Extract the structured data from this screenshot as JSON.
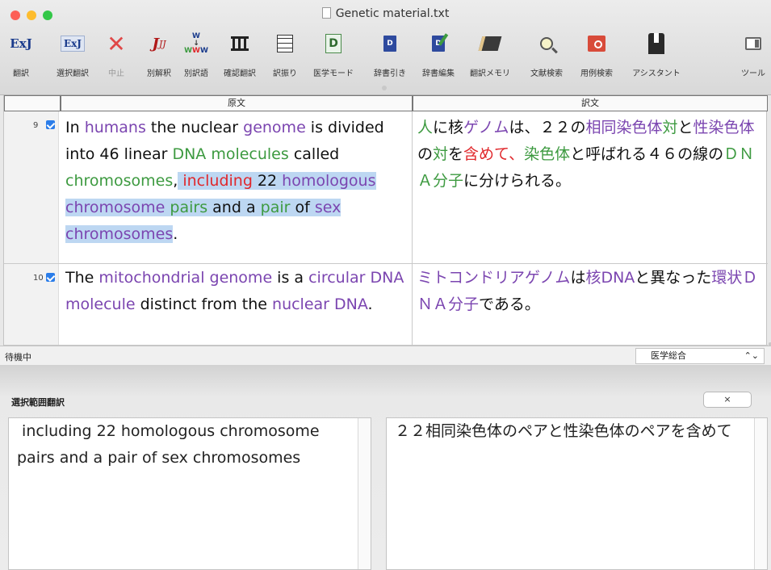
{
  "window": {
    "title": "Genetic material.txt",
    "traffic_colors": [
      "#fc5f57",
      "#fdbc2e",
      "#33c748"
    ]
  },
  "toolbar": [
    {
      "id": "translate",
      "label": "翻訳",
      "icon": "exj-translate-icon",
      "glyph": "ExJ"
    },
    {
      "id": "selection-translate",
      "label": "選択翻訳",
      "icon": "exj-selection-icon",
      "glyph": "ExJ"
    },
    {
      "id": "stop",
      "label": "中止",
      "icon": "stop-x-icon",
      "glyph": "✕"
    },
    {
      "id": "alt-interpretation",
      "label": "別解釈",
      "icon": "alt-interpretation-icon",
      "glyph": "J"
    },
    {
      "id": "alt-word",
      "label": "別訳語",
      "icon": "alt-word-icon",
      "glyph": "W"
    },
    {
      "id": "confirm",
      "label": "確認翻訳",
      "icon": "confirm-columns-icon",
      "glyph": "Ⅲ"
    },
    {
      "id": "furigana",
      "label": "訳振り",
      "icon": "lines-icon",
      "glyph": "☰"
    },
    {
      "id": "medical",
      "label": "医学モード",
      "icon": "medical-mode-icon",
      "glyph": "D"
    },
    {
      "id": "dict-lookup",
      "label": "辞書引き",
      "icon": "dictionary-icon",
      "glyph": "D"
    },
    {
      "id": "dict-edit",
      "label": "辞書編集",
      "icon": "dictionary-edit-icon",
      "glyph": "D"
    },
    {
      "id": "memory",
      "label": "翻訳メモリ",
      "icon": "memory-book-icon",
      "glyph": "▤"
    },
    {
      "id": "literature",
      "label": "文献検索",
      "icon": "magnifier-icon",
      "glyph": "⚲"
    },
    {
      "id": "examples",
      "label": "用例検索",
      "icon": "example-search-icon",
      "glyph": "▦"
    },
    {
      "id": "assistant",
      "label": "アシスタント",
      "icon": "assistant-tuxedo-icon",
      "glyph": "▲"
    },
    {
      "id": "tools",
      "label": "ツール",
      "icon": "tools-panel-icon",
      "glyph": "▯"
    }
  ],
  "grid": {
    "header_source": "原文",
    "header_target": "訳文",
    "rows": [
      {
        "number": "9",
        "checked": true
      },
      {
        "number": "10",
        "checked": true
      }
    ]
  },
  "status": {
    "text": "待機中",
    "dictionary": "医学総合"
  },
  "panel": {
    "title": "選択範囲翻訳",
    "close": "×",
    "source_text": " including 22 homologous chromosome pairs and a pair of sex chromosomes",
    "target_text": "２２相同染色体のペアと性染色体のペアを含めて"
  },
  "colors": {
    "term_purple": "#7b45b0",
    "term_green": "#3d9a40",
    "term_red": "#e0282c",
    "selection": "#bdd7f2"
  }
}
